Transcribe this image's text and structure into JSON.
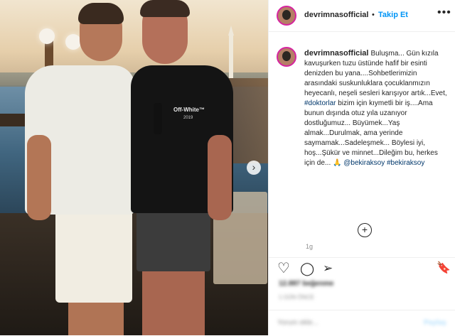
{
  "post": {
    "username": "devrimnasofficial",
    "follow_label": "Takip Et",
    "separator": "•",
    "more_label": "•••",
    "caption_parts": {
      "text_before_tag": "Buluşma... Gün kızıla kavuşurken tuzu üstünde hafif bir esinti denizden bu yana....Sohbetlerimizin arasındaki suskunluklara çocuklanmızın heyecanlı, neşeli sesleri karışıyor artık...Evet, ",
      "tag1": "#doktorlar",
      "text_after_tag": " bizim için kıymetli bir iş....Ama bunun dışında otuz yıla uzanıyor dostluğumuz... Büyümek...Yaş almak...Durulmak, ama yerinde saymamak...Sadeleşmek... Böylesi iyi, hoş...Şükür ve minnet...Dileğim bu, herkes için de... 🙏 ",
      "mention": "@bekiraksoy",
      "tag2": "#bekiraksoy"
    },
    "age": "1g",
    "add_label": "+",
    "likes_text": "12.887 beğenme",
    "date_text": "1 GÜN ÖNCE",
    "comment_placeholder": "Yorum ekle...",
    "post_button": "Paylaş",
    "photo_brand": "Off-White™",
    "photo_brand_year": "2019",
    "next_arrow": "›"
  },
  "icons": {
    "heart": "♡",
    "comment": "◯",
    "share": "➢",
    "bookmark": "🔖"
  },
  "colors": {
    "accent": "#0095f6",
    "story_ring": "#d6249f",
    "tag_link": "#00376b"
  }
}
